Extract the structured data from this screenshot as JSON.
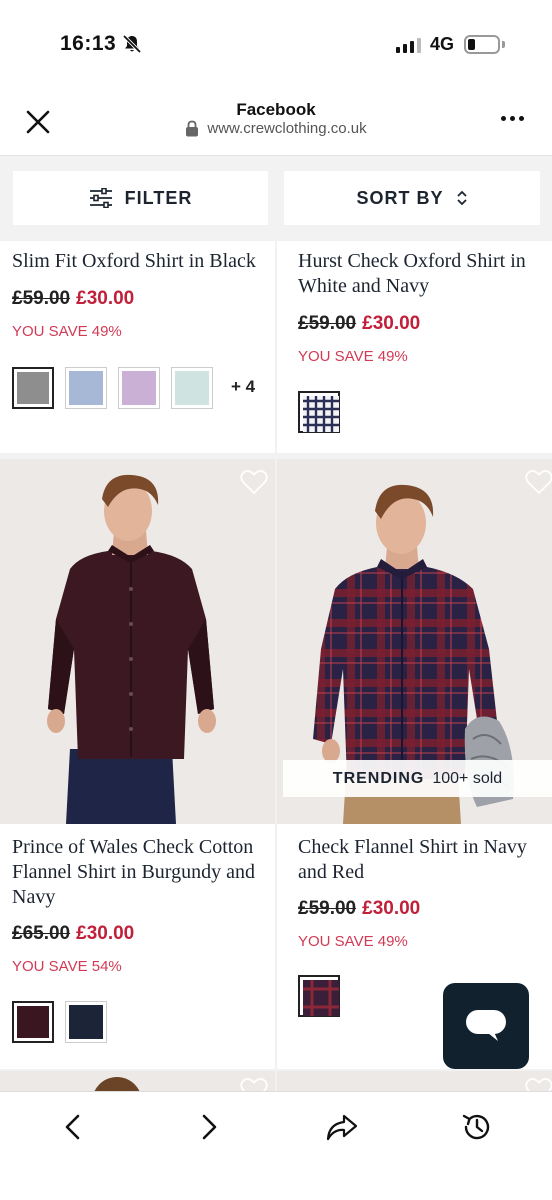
{
  "status_bar": {
    "time": "16:13",
    "network": "4G"
  },
  "browser": {
    "title": "Facebook",
    "url": "www.crewclothing.co.uk"
  },
  "toolbar": {
    "filter_label": "FILTER",
    "sort_label": "SORT BY"
  },
  "products": [
    {
      "name": "Slim Fit Oxford Shirt in Black",
      "old_price": "£59.00",
      "price": "£30.00",
      "savings": "YOU SAVE 49%",
      "swatches": [
        "#8e8e8e",
        "#a7b8d6",
        "#cbb0d6",
        "#cfe4e0"
      ],
      "more_swatches": "+ 4"
    },
    {
      "name": "Hurst Check Oxford Shirt in White and Navy",
      "old_price": "£59.00",
      "price": "£30.00",
      "savings": "YOU SAVE 49%",
      "swatches": [
        "check-navy-white"
      ]
    },
    {
      "name": "Prince of Wales Check Cotton Flannel Shirt in Burgundy and Navy",
      "old_price": "£65.00",
      "price": "£30.00",
      "savings": "YOU SAVE 54%",
      "swatches": [
        "#3a1620",
        "#1c2438"
      ]
    },
    {
      "name": "Check Flannel Shirt in Navy and Red",
      "old_price": "£59.00",
      "price": "£30.00",
      "savings": "YOU SAVE 49%",
      "swatches": [
        "check-red-navy"
      ],
      "badge_label": "TRENDING",
      "badge_text": "100+ sold"
    }
  ],
  "colors": {
    "sale_red": "#c0203a",
    "save_pink": "#d23a55",
    "navy_text": "#1c2430",
    "chat_bg": "#11222e"
  }
}
